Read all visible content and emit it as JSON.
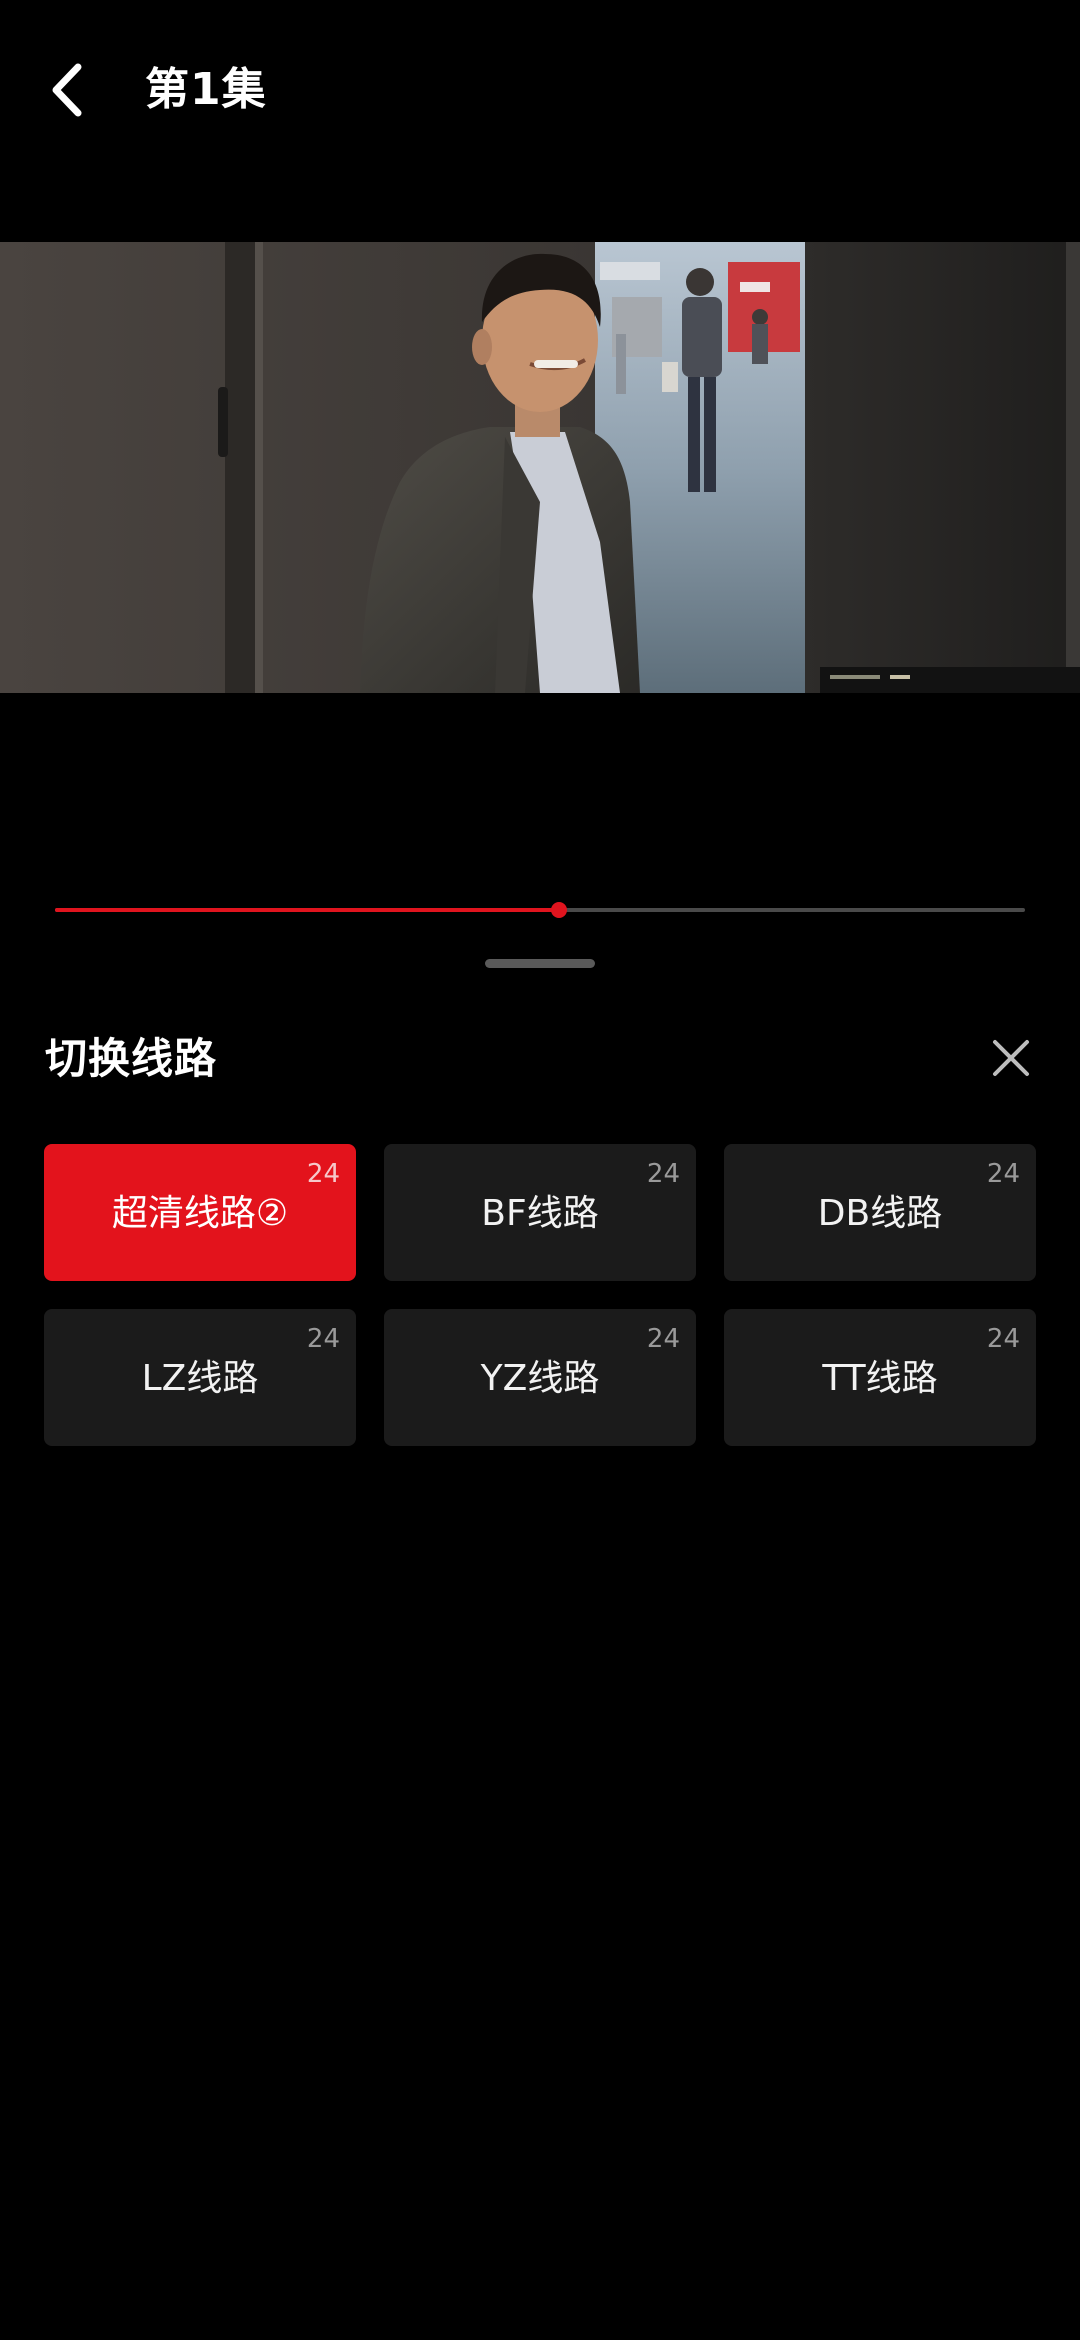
{
  "header": {
    "back_icon": "chevron-left-icon",
    "title": "第1集"
  },
  "player": {
    "progress_fraction": 0.52,
    "played_color": "#e0141e",
    "track_color": "#4a4a4a"
  },
  "sheet": {
    "title": "切换线路",
    "close_icon": "close-icon",
    "accent_color": "#e3131c",
    "routes": [
      {
        "label": "超清线路②",
        "count": "24",
        "selected": true
      },
      {
        "label": "BF线路",
        "count": "24",
        "selected": false
      },
      {
        "label": "DB线路",
        "count": "24",
        "selected": false
      },
      {
        "label": "LZ线路",
        "count": "24",
        "selected": false
      },
      {
        "label": "YZ线路",
        "count": "24",
        "selected": false
      },
      {
        "label": "TT线路",
        "count": "24",
        "selected": false
      }
    ]
  }
}
